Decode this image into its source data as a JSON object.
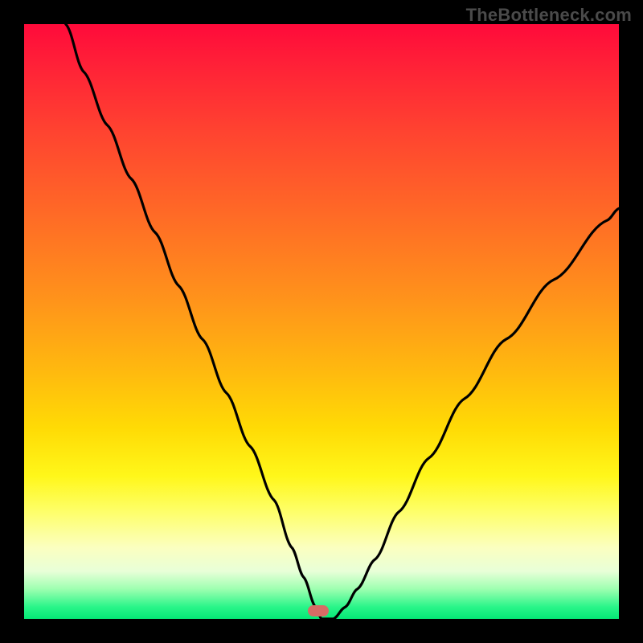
{
  "watermark": "TheBottleneck.com",
  "marker": {
    "x_pct": 49.5,
    "y_pct": 99.0
  },
  "chart_data": {
    "type": "line",
    "title": "",
    "xlabel": "",
    "ylabel": "",
    "xlim": [
      0,
      100
    ],
    "ylim": [
      0,
      100
    ],
    "series": [
      {
        "name": "bottleneck-curve",
        "x": [
          7,
          10,
          14,
          18,
          22,
          26,
          30,
          34,
          38,
          42,
          45,
          47,
          49,
          50,
          52,
          54,
          56,
          59,
          63,
          68,
          74,
          81,
          89,
          98,
          100
        ],
        "y": [
          100,
          92,
          83,
          74,
          65,
          56,
          47,
          38,
          29,
          20,
          12,
          7,
          2,
          0,
          0,
          2,
          5,
          10,
          18,
          27,
          37,
          47,
          57,
          67,
          69
        ]
      }
    ],
    "annotations": [
      {
        "text": "TheBottleneck.com",
        "role": "watermark",
        "pos": "top-right"
      }
    ],
    "background_gradient": {
      "direction": "top-to-bottom",
      "stops": [
        {
          "pct": 0,
          "color": "#ff0a3a"
        },
        {
          "pct": 32,
          "color": "#ff6a26"
        },
        {
          "pct": 68,
          "color": "#ffdb05"
        },
        {
          "pct": 88,
          "color": "#fbffc0"
        },
        {
          "pct": 100,
          "color": "#05e876"
        }
      ]
    },
    "marker": {
      "x": 49.5,
      "y": 0,
      "color": "#d76b65",
      "shape": "pill"
    }
  }
}
